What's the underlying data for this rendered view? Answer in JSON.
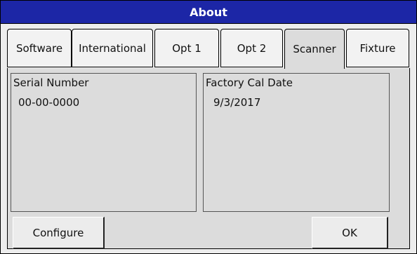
{
  "window": {
    "title": "About"
  },
  "tabs": [
    {
      "label": "Software"
    },
    {
      "label": "International"
    },
    {
      "label": "Opt 1"
    },
    {
      "label": "Opt 2"
    },
    {
      "label": "Scanner",
      "active": true
    },
    {
      "label": "Fixture"
    }
  ],
  "panels": {
    "serial": {
      "title": "Serial Number",
      "value": "00-00-0000"
    },
    "cal_date": {
      "title": "Factory Cal Date",
      "value": "9/3/2017"
    }
  },
  "buttons": {
    "configure": "Configure",
    "ok": "OK"
  },
  "colors": {
    "title_bar": "#1c26a6",
    "window_bg": "#ededed",
    "panel_bg": "#dcdcdc"
  }
}
